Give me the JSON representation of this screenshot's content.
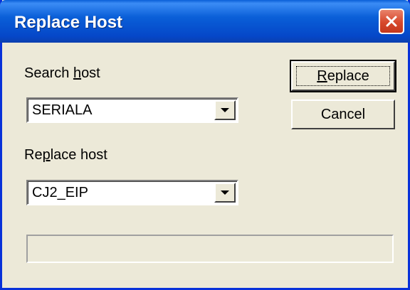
{
  "window": {
    "title": "Replace Host"
  },
  "search": {
    "label_pre": "Search ",
    "label_acc": "h",
    "label_post": "ost",
    "value": "SERIALA"
  },
  "replace": {
    "label_pre": "Re",
    "label_acc": "p",
    "label_post": "lace host",
    "value": "CJ2_EIP"
  },
  "buttons": {
    "replace_acc": "R",
    "replace_rest": "eplace",
    "cancel": "Cancel"
  },
  "progress": {
    "fraction": 0
  },
  "icons": {
    "close": "close-icon",
    "dropdown": "chevron-down-icon"
  },
  "colors": {
    "titlebar": "#0a5fd8",
    "close": "#d7482c",
    "dialog_bg": "#ece9d8"
  }
}
